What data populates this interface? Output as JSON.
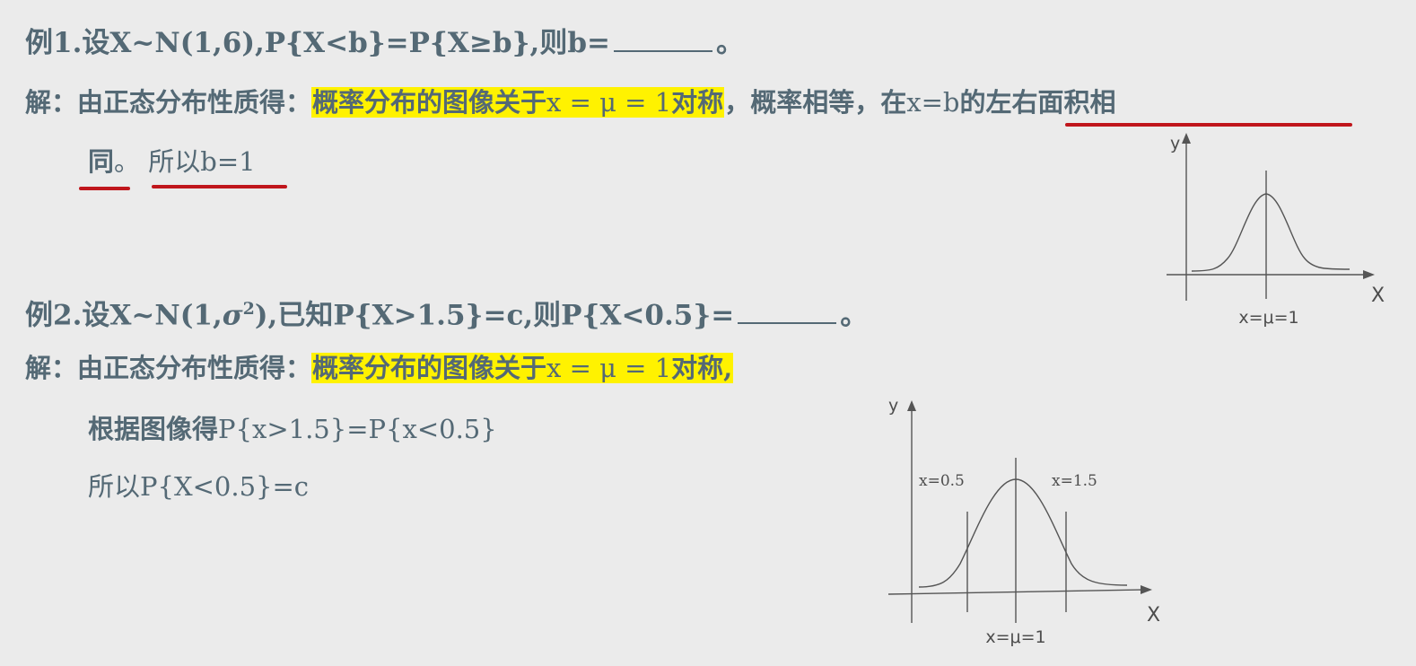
{
  "example1": {
    "title": "例1.",
    "question_a": "设",
    "question_b": "X~N(1,6),P{X<b}=P{X≥b},",
    "question_c": "则",
    "question_d": "b=",
    "question_end": "。",
    "sol_label": "解：由正态分布性质得：",
    "sol_hl_cn": "概率分布的图像关于",
    "sol_hl_math": "x = μ = 1",
    "sol_hl_cn2": "对称",
    "sol_comma": "，",
    "sol_mid": "概率相等，",
    "sol_at": "在",
    "sol_at_math": "x=b",
    "sol_tail": "的左右面积相",
    "line3_a": "同",
    "line3_b": "。",
    "line3_c": "所以b=1"
  },
  "example2": {
    "title": "例2.",
    "question_a": "设",
    "question_b": "X~N(1,",
    "question_sigma": "σ",
    "question_sup": "2",
    "question_c": "),",
    "question_d": "已知",
    "question_e": "P{X>1.5}=c,",
    "question_f": "则",
    "question_g": "P{X<0.5}=",
    "question_end": "。",
    "sol_label": "解：由正态分布性质得：",
    "sol_hl_cn": "概率分布的图像关于",
    "sol_hl_math": "x = μ = 1",
    "sol_hl_cn2": "对称",
    "sol_comma": ",",
    "line2_cn": "根据图像得",
    "line2_math": "P{x>1.5}=P{x<0.5}",
    "line3": "所以P{X<0.5}=c"
  },
  "graph1": {
    "y_label": "y",
    "x_label": "X",
    "center_label": "x=μ=1"
  },
  "graph2": {
    "y_label": "y",
    "x_label": "X",
    "center_label": "x=μ=1",
    "left_label": "x=0.5",
    "right_label": "x=1.5"
  },
  "colors": {
    "text": "#546975",
    "highlight": "#fff200",
    "underline": "#c0161c",
    "background": "#ebebeb"
  }
}
